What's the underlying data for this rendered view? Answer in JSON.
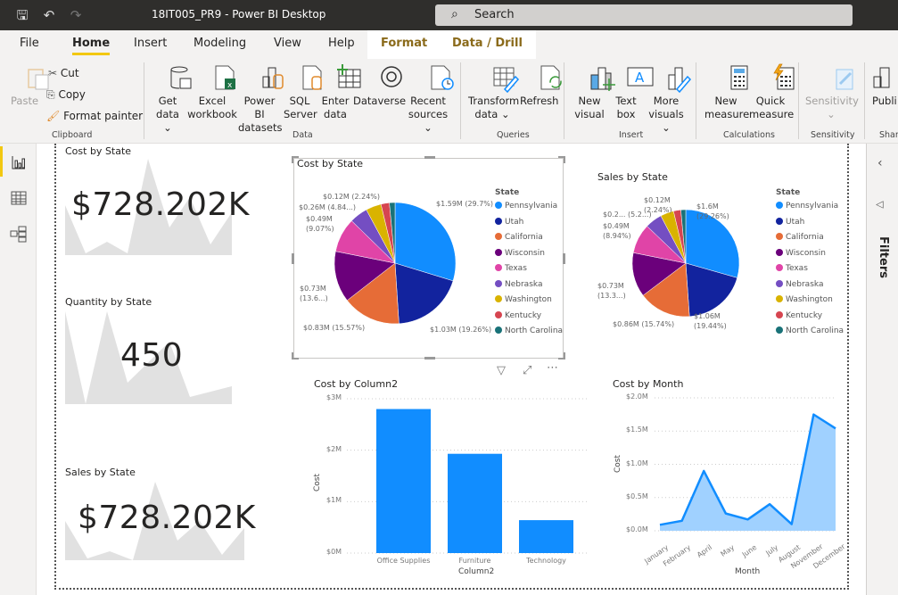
{
  "window": {
    "title": "18IT005_PR9 - Power BI Desktop",
    "search_placeholder": "Search"
  },
  "tabs": [
    {
      "label": "File"
    },
    {
      "label": "Home"
    },
    {
      "label": "Insert"
    },
    {
      "label": "Modeling"
    },
    {
      "label": "View"
    },
    {
      "label": "Help"
    },
    {
      "label": "Format"
    },
    {
      "label": "Data / Drill"
    }
  ],
  "ribbon": {
    "clipboard": {
      "paste": "Paste",
      "cut": "Cut",
      "copy": "Copy",
      "format_painter": "Format painter",
      "group": "Clipboard"
    },
    "data": {
      "get_data": [
        "Get",
        "data ⌄"
      ],
      "excel": [
        "Excel",
        "workbook"
      ],
      "pbi_datasets": [
        "Power BI",
        "datasets"
      ],
      "sql": [
        "SQL",
        "Server"
      ],
      "enter_data": [
        "Enter",
        "data"
      ],
      "dataverse": [
        "Dataverse",
        ""
      ],
      "recent": [
        "Recent",
        "sources ⌄"
      ],
      "group": "Data"
    },
    "queries": {
      "transform": [
        "Transform",
        "data ⌄"
      ],
      "refresh": [
        "Refresh",
        ""
      ],
      "group": "Queries"
    },
    "insert": {
      "new_visual": [
        "New",
        "visual"
      ],
      "text_box": [
        "Text",
        "box"
      ],
      "more_visuals": [
        "More",
        "visuals ⌄"
      ],
      "group": "Insert"
    },
    "calculations": {
      "new_measure": [
        "New",
        "measure"
      ],
      "quick_measure": [
        "Quick",
        "measure"
      ],
      "group": "Calculations"
    },
    "sensitivity": {
      "label": [
        "Sensitivity",
        "⌄"
      ],
      "group": "Sensitivity"
    },
    "share": {
      "publish": "Publi",
      "group": "Shar"
    }
  },
  "filters_pane": {
    "label": "Filters"
  },
  "cards": [
    {
      "title": "Cost by State",
      "value": "$728.202K"
    },
    {
      "title": "Quantity by State",
      "value": "450"
    },
    {
      "title": "Sales by State",
      "value": "$728.202K"
    }
  ],
  "chart_data": [
    {
      "type": "pie",
      "title": "Cost by State",
      "legend_title": "State",
      "legend_position": "right",
      "categories": [
        "Pennsylvania",
        "Utah",
        "California",
        "Wisconsin",
        "Texas",
        "Nebraska",
        "Washington",
        "Kentucky",
        "North Carolina"
      ],
      "values": [
        1.59,
        1.03,
        0.83,
        0.73,
        0.49,
        0.26,
        0.22,
        0.12,
        0.08
      ],
      "unit": "$M",
      "colors": [
        "#118dff",
        "#12239e",
        "#e66c37",
        "#6b007b",
        "#e044a7",
        "#744ec2",
        "#d9b300",
        "#d64550",
        "#197278"
      ],
      "data_labels": [
        {
          "text": "$1.59M (29.7%)"
        },
        {
          "text": "$1.03M (19.26%)"
        },
        {
          "text": "$0.83M (15.57%)"
        },
        {
          "text": "$0.73M",
          "text2": "(13.6...)"
        },
        {
          "text": "$0.49M",
          "text2": "(9.07%)"
        },
        {
          "text": "$0.26M (4.84...)"
        },
        {
          "text": "$0.12M (2.24%)"
        }
      ]
    },
    {
      "type": "pie",
      "title": "Sales by State",
      "legend_title": "State",
      "legend_position": "right",
      "categories": [
        "Pennsylvania",
        "Utah",
        "California",
        "Wisconsin",
        "Texas",
        "Nebraska",
        "Washington",
        "Kentucky",
        "North Carolina"
      ],
      "values": [
        1.6,
        1.06,
        0.86,
        0.73,
        0.49,
        0.28,
        0.22,
        0.12,
        0.08
      ],
      "unit": "$M",
      "colors": [
        "#118dff",
        "#12239e",
        "#e66c37",
        "#6b007b",
        "#e044a7",
        "#744ec2",
        "#d9b300",
        "#d64550",
        "#197278"
      ],
      "data_labels": [
        {
          "text": "$1.6M",
          "text2": "(29.26%)"
        },
        {
          "text": "$1.06M",
          "text2": "(19.44%)"
        },
        {
          "text": "$0.86M (15.74%)"
        },
        {
          "text": "$0.73M",
          "text2": "(13.3...)"
        },
        {
          "text": "$0.49M",
          "text2": "(8.94%)"
        },
        {
          "text": "$0.2... (5.2...)"
        },
        {
          "text": "$0.12M",
          "text2": "(2.24%)"
        }
      ]
    },
    {
      "type": "bar",
      "title": "Cost by Column2",
      "xlabel": "Column2",
      "ylabel": "Cost",
      "categories": [
        "Office Supplies",
        "Furniture",
        "Technology"
      ],
      "values": [
        2.8,
        1.93,
        0.64
      ],
      "unit": "$M",
      "ylim": [
        0,
        3
      ],
      "yticks": [
        "$0M",
        "$1M",
        "$2M",
        "$3M"
      ],
      "grid": true,
      "color": "#118dff"
    },
    {
      "type": "area",
      "title": "Cost by Month",
      "xlabel": "Month",
      "ylabel": "Cost",
      "categories": [
        "January",
        "February",
        "April",
        "May",
        "June",
        "July",
        "August",
        "November",
        "December"
      ],
      "values": [
        0.09,
        0.15,
        0.9,
        0.26,
        0.17,
        0.4,
        0.1,
        1.75,
        1.54
      ],
      "unit": "$M",
      "ylim": [
        0,
        2.0
      ],
      "yticks": [
        "$0.0M",
        "$0.5M",
        "$1.0M",
        "$1.5M",
        "$2.0M"
      ],
      "grid": true,
      "line_color": "#118dff",
      "fill_color": "#a0d1ff"
    }
  ]
}
